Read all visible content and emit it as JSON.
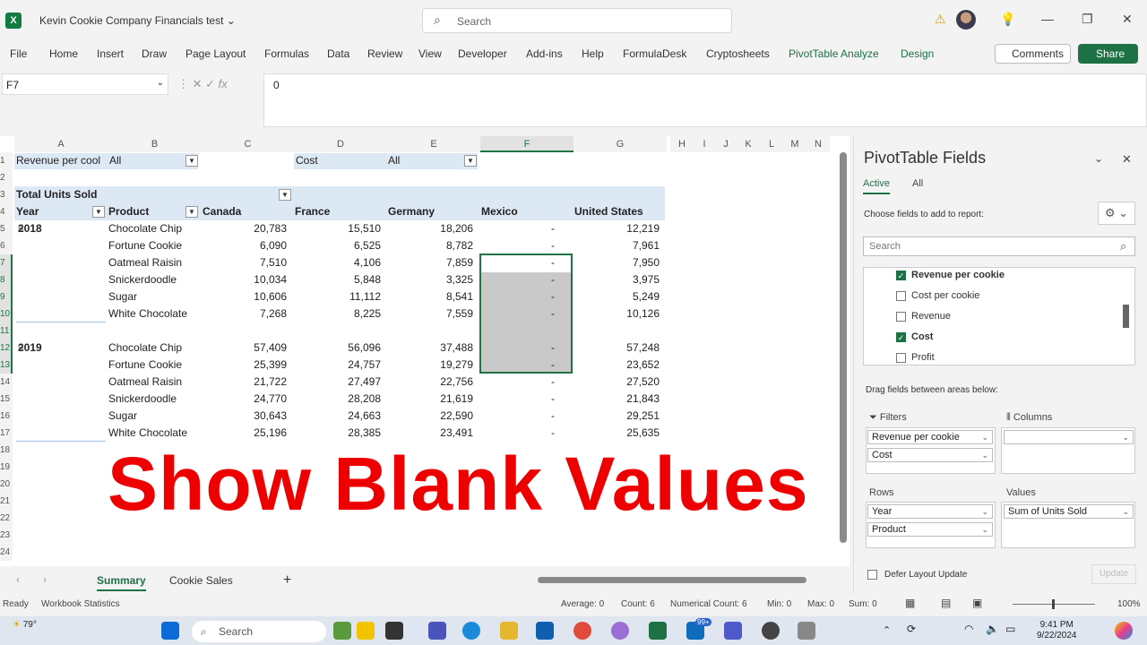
{
  "window": {
    "title": "Kevin Cookie Company Financials test",
    "search_placeholder": "Search"
  },
  "ribbon": {
    "tabs": [
      "File",
      "Home",
      "Insert",
      "Draw",
      "Page Layout",
      "Formulas",
      "Data",
      "Review",
      "View",
      "Developer",
      "Add-ins",
      "Help",
      "FormulaDesk",
      "Cryptosheets",
      "PivotTable Analyze",
      "Design"
    ],
    "comments": "Comments",
    "share": "Share"
  },
  "formula_bar": {
    "name_box": "F7",
    "fx": "fx",
    "value": "0"
  },
  "columns": [
    "A",
    "B",
    "C",
    "D",
    "E",
    "F",
    "G",
    "H",
    "I",
    "J",
    "K",
    "L",
    "M",
    "N"
  ],
  "rows": [
    "1",
    "2",
    "3",
    "4",
    "5",
    "6",
    "7",
    "8",
    "9",
    "10",
    "11",
    "12",
    "13",
    "14",
    "15",
    "16",
    "17",
    "18",
    "19",
    "20",
    "21",
    "22",
    "23",
    "24"
  ],
  "filters": {
    "f1_label": "Revenue per cool",
    "f1_value": "All",
    "f2_label": "Cost",
    "f2_value": "All"
  },
  "pivot": {
    "values_label": "Total Units Sold",
    "year_header": "Year",
    "product_header": "Product",
    "countries": [
      "Canada",
      "France",
      "Germany",
      "Mexico",
      "United States"
    ],
    "groups": [
      {
        "year": "2018",
        "rows": [
          {
            "product": "Chocolate Chip",
            "values": [
              "20,783",
              "15,510",
              "18,206",
              "-",
              "12,219"
            ]
          },
          {
            "product": "Fortune Cookie",
            "values": [
              "6,090",
              "6,525",
              "8,782",
              "-",
              "7,961"
            ]
          },
          {
            "product": "Oatmeal Raisin",
            "values": [
              "7,510",
              "4,106",
              "7,859",
              "-",
              "7,950"
            ]
          },
          {
            "product": "Snickerdoodle",
            "values": [
              "10,034",
              "5,848",
              "3,325",
              "-",
              "3,975"
            ]
          },
          {
            "product": "Sugar",
            "values": [
              "10,606",
              "11,112",
              "8,541",
              "-",
              "5,249"
            ]
          },
          {
            "product": "White Chocolate",
            "values": [
              "7,268",
              "8,225",
              "7,559",
              "-",
              "10,126"
            ]
          }
        ]
      },
      {
        "year": "2019",
        "rows": [
          {
            "product": "Chocolate Chip",
            "values": [
              "57,409",
              "56,096",
              "37,488",
              "-",
              "57,248"
            ]
          },
          {
            "product": "Fortune Cookie",
            "values": [
              "25,399",
              "24,757",
              "19,279",
              "-",
              "23,652"
            ]
          },
          {
            "product": "Oatmeal Raisin",
            "values": [
              "21,722",
              "27,497",
              "22,756",
              "-",
              "27,520"
            ]
          },
          {
            "product": "Snickerdoodle",
            "values": [
              "24,770",
              "28,208",
              "21,619",
              "-",
              "21,843"
            ]
          },
          {
            "product": "Sugar",
            "values": [
              "30,643",
              "24,663",
              "22,590",
              "-",
              "29,251"
            ]
          },
          {
            "product": "White Chocolate",
            "values": [
              "25,196",
              "28,385",
              "23,491",
              "-",
              "25,635"
            ]
          }
        ]
      }
    ]
  },
  "sheets": {
    "tabs": [
      "Summary",
      "Cookie Sales"
    ],
    "active": "Summary",
    "add": "+"
  },
  "status": {
    "ready": "Ready",
    "workbook_stats": "Workbook Statistics",
    "average": "Average: 0",
    "count": "Count: 6",
    "numerical_count": "Numerical Count: 6",
    "min": "Min: 0",
    "max": "Max: 0",
    "sum": "Sum: 0",
    "zoom": "100%"
  },
  "pane": {
    "title": "PivotTable Fields",
    "tab_active": "Active",
    "tab_all": "All",
    "choose": "Choose fields to add to report:",
    "search_placeholder": "Search",
    "fields": [
      {
        "name": "Revenue per cookie",
        "checked": true,
        "bold": true
      },
      {
        "name": "Cost per cookie",
        "checked": false,
        "bold": false
      },
      {
        "name": "Revenue",
        "checked": false,
        "bold": false
      },
      {
        "name": "Cost",
        "checked": true,
        "bold": true
      },
      {
        "name": "Profit",
        "checked": false,
        "bold": false
      }
    ],
    "drag": "Drag fields between areas below:",
    "filters_label": "Filters",
    "columns_label": "Columns",
    "rows_label": "Rows",
    "values_label": "Values",
    "filter_chips": [
      "Revenue per cookie",
      "Cost"
    ],
    "row_chips": [
      "Year",
      "Product"
    ],
    "value_chip": "Sum of Units Sold",
    "defer": "Defer Layout Update",
    "update": "Update"
  },
  "overlay_text": "Show Blank Values",
  "taskbar": {
    "weather": "79°",
    "search": "Search",
    "time": "9:41 PM",
    "date": "9/22/2024",
    "teams_badge": "99+"
  },
  "colors": {
    "excel_green": "#1e7145",
    "overlay_red": "#ee0000",
    "pivot_blue": "#dde8f5"
  }
}
